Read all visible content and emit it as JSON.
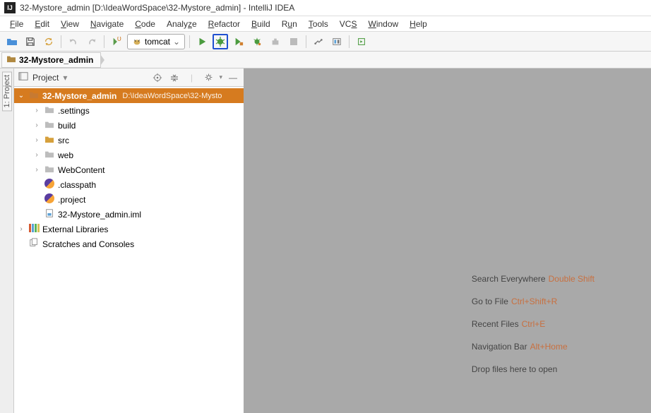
{
  "title": "32-Mystore_admin [D:\\IdeaWordSpace\\32-Mystore_admin] - IntelliJ IDEA",
  "menu": [
    "File",
    "Edit",
    "View",
    "Navigate",
    "Code",
    "Analyze",
    "Refactor",
    "Build",
    "Run",
    "Tools",
    "VCS",
    "Window",
    "Help"
  ],
  "runConfig": "tomcat",
  "breadcrumb": {
    "root": "32-Mystore_admin"
  },
  "sideTab": "1: Project",
  "panel": {
    "title": "Project"
  },
  "tree": {
    "root": {
      "name": "32-Mystore_admin",
      "path": "D:\\IdeaWordSpace\\32-Mysto"
    },
    "children": [
      {
        "name": ".settings",
        "type": "folder-gray",
        "expandable": true
      },
      {
        "name": "build",
        "type": "folder-gray",
        "expandable": true
      },
      {
        "name": "src",
        "type": "folder",
        "expandable": true
      },
      {
        "name": "web",
        "type": "folder-gray",
        "expandable": true
      },
      {
        "name": "WebContent",
        "type": "folder-gray",
        "expandable": true
      },
      {
        "name": ".classpath",
        "type": "eclipse",
        "expandable": false
      },
      {
        "name": ".project",
        "type": "eclipse",
        "expandable": false
      },
      {
        "name": "32-Mystore_admin.iml",
        "type": "iml",
        "expandable": false
      }
    ],
    "ext": [
      {
        "name": "External Libraries",
        "type": "lib"
      },
      {
        "name": "Scratches and Consoles",
        "type": "scratch"
      }
    ]
  },
  "welcome": [
    {
      "label": "Search Everywhere",
      "hotkey": "Double Shift"
    },
    {
      "label": "Go to File",
      "hotkey": "Ctrl+Shift+R"
    },
    {
      "label": "Recent Files",
      "hotkey": "Ctrl+E"
    },
    {
      "label": "Navigation Bar",
      "hotkey": "Alt+Home"
    },
    {
      "label": "Drop files here to open",
      "hotkey": ""
    }
  ]
}
